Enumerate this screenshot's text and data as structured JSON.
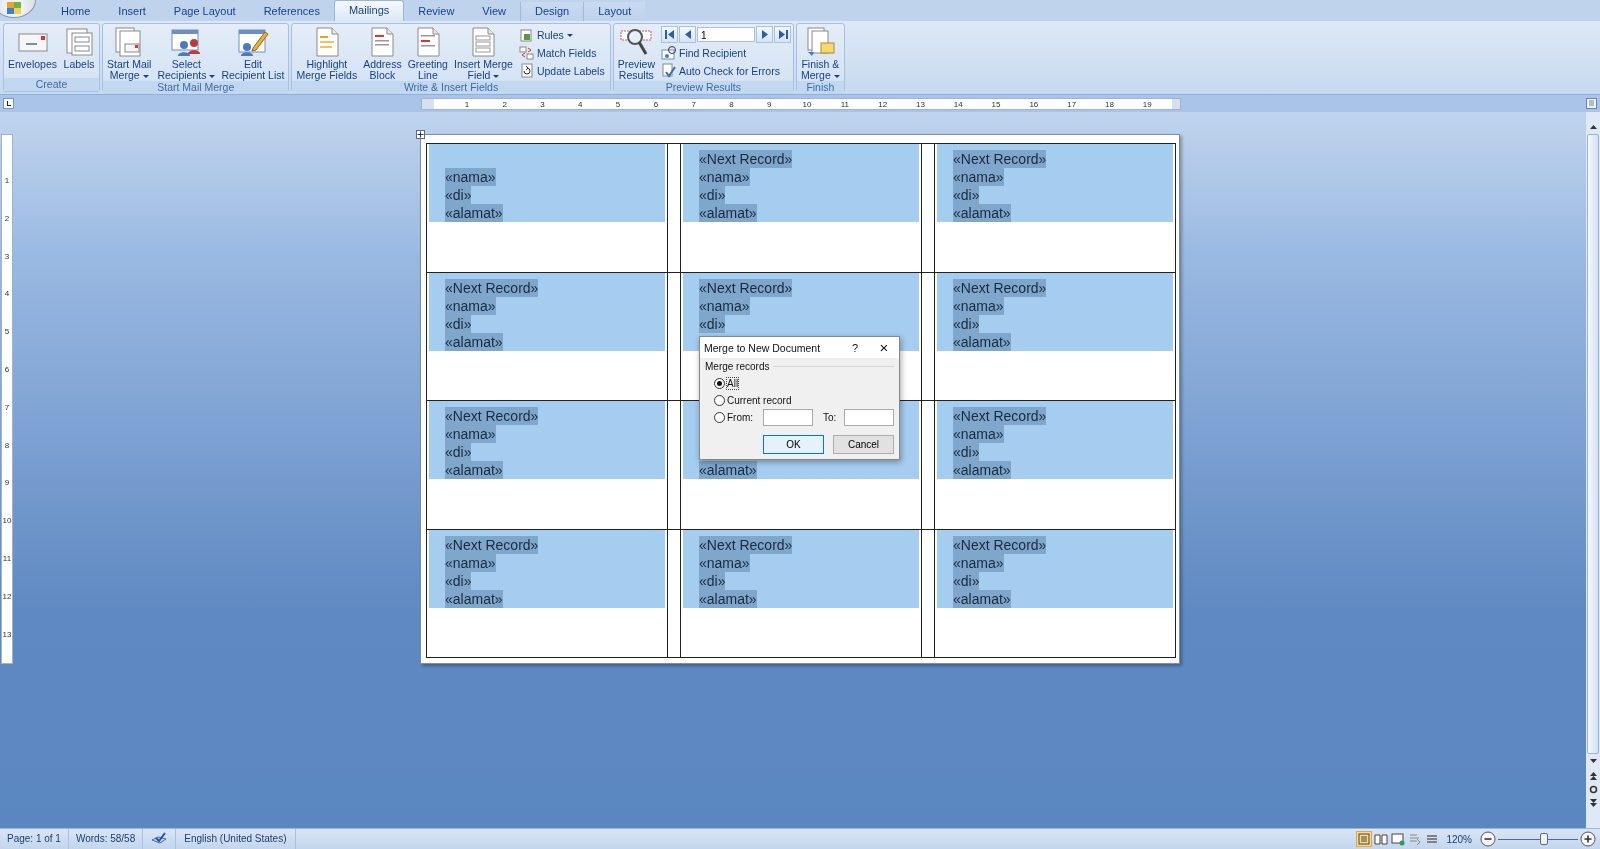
{
  "tabs": [
    {
      "label": "Home",
      "selected": false,
      "contextual": false
    },
    {
      "label": "Insert",
      "selected": false,
      "contextual": false
    },
    {
      "label": "Page Layout",
      "selected": false,
      "contextual": false
    },
    {
      "label": "References",
      "selected": false,
      "contextual": false
    },
    {
      "label": "Mailings",
      "selected": true,
      "contextual": false
    },
    {
      "label": "Review",
      "selected": false,
      "contextual": false
    },
    {
      "label": "View",
      "selected": false,
      "contextual": false
    },
    {
      "label": "Design",
      "selected": false,
      "contextual": true
    },
    {
      "label": "Layout",
      "selected": false,
      "contextual": true
    }
  ],
  "ribbon": {
    "groups": [
      {
        "label": "Create",
        "items": [
          {
            "kind": "large",
            "lines": [
              "Envelopes"
            ],
            "dropdown": false
          },
          {
            "kind": "large",
            "lines": [
              "Labels"
            ],
            "dropdown": false
          }
        ]
      },
      {
        "label": "Start Mail Merge",
        "items": [
          {
            "kind": "large",
            "lines": [
              "Start Mail",
              "Merge"
            ],
            "dropdown": true
          },
          {
            "kind": "large",
            "lines": [
              "Select",
              "Recipients"
            ],
            "dropdown": true
          },
          {
            "kind": "large",
            "lines": [
              "Edit",
              "Recipient List"
            ],
            "dropdown": false
          }
        ]
      },
      {
        "label": "Write & Insert Fields",
        "items": [
          {
            "kind": "large",
            "lines": [
              "Highlight",
              "Merge Fields"
            ],
            "dropdown": false
          },
          {
            "kind": "large",
            "lines": [
              "Address",
              "Block"
            ],
            "dropdown": false
          },
          {
            "kind": "large",
            "lines": [
              "Greeting",
              "Line"
            ],
            "dropdown": false
          },
          {
            "kind": "large",
            "lines": [
              "Insert Merge",
              "Field"
            ],
            "dropdown": true
          },
          {
            "kind": "stack",
            "items": [
              {
                "kind": "small",
                "label": "Rules",
                "dropdown": true
              },
              {
                "kind": "small",
                "label": "Match Fields",
                "dropdown": false
              },
              {
                "kind": "small",
                "label": "Update Labels",
                "dropdown": false
              }
            ]
          }
        ]
      },
      {
        "label": "Preview Results",
        "items": [
          {
            "kind": "large",
            "lines": [
              "Preview",
              "Results"
            ],
            "dropdown": false
          },
          {
            "kind": "stack",
            "items": [
              {
                "kind": "nav",
                "value": "1"
              },
              {
                "kind": "small",
                "label": "Find Recipient",
                "dropdown": false
              },
              {
                "kind": "small",
                "label": "Auto Check for Errors",
                "dropdown": false
              }
            ]
          }
        ]
      },
      {
        "label": "Finish",
        "items": [
          {
            "kind": "large",
            "lines": [
              "Finish &",
              "Merge"
            ],
            "dropdown": true
          }
        ]
      }
    ]
  },
  "rulers": {
    "horizontal": [
      "1",
      "2",
      "3",
      "4",
      "5",
      "6",
      "7",
      "8",
      "9",
      "10",
      "11",
      "12",
      "13",
      "14",
      "15",
      "16",
      "17",
      "18",
      "19"
    ],
    "vertical": [
      "1",
      "2",
      "3",
      "4",
      "5",
      "6",
      "7",
      "8",
      "9",
      "10",
      "11",
      "12",
      "13"
    ]
  },
  "label_rows": [
    {
      "cells": [
        {
          "blank_first_line": true,
          "fields": [
            "«nama»",
            "«di»",
            "«alamat»"
          ]
        },
        {
          "blank_first_line": false,
          "fields": [
            "«Next Record»",
            "«nama»",
            "«di»",
            "«alamat»"
          ]
        },
        {
          "blank_first_line": false,
          "fields": [
            "«Next Record»",
            "«nama»",
            "«di»",
            "«alamat»"
          ]
        }
      ]
    },
    {
      "cells": [
        {
          "blank_first_line": false,
          "fields": [
            "«Next Record»",
            "«nama»",
            "«di»",
            "«alamat»"
          ]
        },
        {
          "blank_first_line": false,
          "fields": [
            "«Next Record»",
            "«nama»",
            "«di»"
          ]
        },
        {
          "blank_first_line": false,
          "fields": [
            "«Next Record»",
            "«nama»",
            "«di»",
            "«alamat»"
          ]
        }
      ]
    },
    {
      "cells": [
        {
          "blank_first_line": false,
          "fields": [
            "«Next Record»",
            "«nama»",
            "«di»",
            "«alamat»"
          ]
        },
        {
          "blank_first_line": false,
          "fields": [
            "«alamat»"
          ],
          "covered": true
        },
        {
          "blank_first_line": false,
          "fields": [
            "«Next Record»",
            "«nama»",
            "«di»",
            "«alamat»"
          ]
        }
      ]
    },
    {
      "cells": [
        {
          "blank_first_line": false,
          "fields": [
            "«Next Record»",
            "«nama»",
            "«di»",
            "«alamat»"
          ]
        },
        {
          "blank_first_line": false,
          "fields": [
            "«Next Record»",
            "«nama»",
            "«di»",
            "«alamat»"
          ]
        },
        {
          "blank_first_line": false,
          "fields": [
            "«Next Record»",
            "«nama»",
            "«di»",
            "«alamat»"
          ]
        }
      ]
    }
  ],
  "dialog": {
    "title": "Merge to New Document",
    "help": "?",
    "close": "×",
    "group": "Merge records",
    "options": [
      {
        "label": "All",
        "selected": true
      },
      {
        "label": "Current record",
        "selected": false
      },
      {
        "label": "From:",
        "selected": false
      }
    ],
    "to_label": "To:",
    "buttons": [
      {
        "label": "OK",
        "default": true
      },
      {
        "label": "Cancel",
        "default": false
      }
    ]
  },
  "status_bar": {
    "items": [
      "Page: 1 of 1",
      "Words: 58/58"
    ],
    "language": "English (United States)",
    "views": [
      {
        "selected": true
      },
      {
        "selected": false
      },
      {
        "selected": false
      },
      {
        "selected": false
      },
      {
        "selected": false
      }
    ],
    "zoom": "120%",
    "zoom_slider": {
      "level": 0.57
    }
  }
}
